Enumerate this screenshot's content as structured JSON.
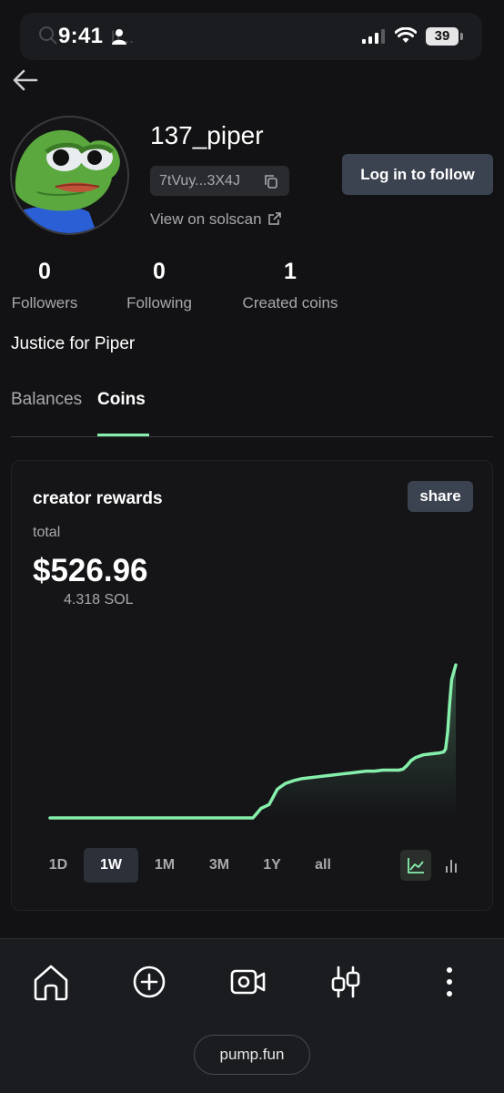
{
  "status_bar": {
    "time": "9:41",
    "battery": "39",
    "search_hint": "h..."
  },
  "profile": {
    "username": "137_piper",
    "address_short": "7tVuy...3X4J",
    "solscan_link": "View on solscan",
    "follow_button": "Log in to follow",
    "bio": "Justice for Piper",
    "stats": [
      {
        "value": "0",
        "label": "Followers"
      },
      {
        "value": "0",
        "label": "Following"
      },
      {
        "value": "1",
        "label": "Created coins"
      }
    ]
  },
  "tabs": [
    {
      "label": "Balances",
      "active": false
    },
    {
      "label": "Coins",
      "active": true
    }
  ],
  "rewards_card": {
    "title": "creator rewards",
    "share_button": "share",
    "total_label": "total",
    "total_value": "$526.96",
    "sol_value": "4.318 SOL",
    "ranges": [
      "1D",
      "1W",
      "1M",
      "3M",
      "1Y",
      "all"
    ],
    "active_range": "1W",
    "accent_color": "#86efac",
    "chart_modes": [
      "line-chart-icon",
      "bar-chart-icon"
    ],
    "active_mode": "line-chart-icon"
  },
  "chart_data": {
    "type": "area",
    "title": "",
    "xlabel": "",
    "ylabel": "",
    "grid": false,
    "x": [
      0,
      0.08,
      0.16,
      0.24,
      0.32,
      0.4,
      0.48,
      0.5,
      0.51,
      0.52,
      0.53,
      0.54,
      0.55,
      0.56,
      0.57,
      0.58,
      0.6,
      0.62,
      0.64,
      0.66,
      0.68,
      0.7,
      0.72,
      0.74,
      0.76,
      0.78,
      0.8,
      0.82,
      0.84,
      0.86,
      0.87,
      0.88,
      0.89,
      0.9,
      0.92,
      0.94,
      0.96,
      0.97,
      0.975,
      0.98,
      0.985,
      0.99,
      1.0
    ],
    "values": [
      0,
      0,
      0,
      0,
      0,
      0,
      0,
      0,
      5,
      10,
      12,
      14,
      22,
      30,
      33,
      36,
      39,
      41,
      42,
      43,
      44,
      45,
      46,
      47,
      48,
      49,
      49,
      50,
      50,
      50,
      51,
      55,
      60,
      63,
      66,
      67,
      68,
      69,
      72,
      90,
      120,
      145,
      160
    ]
  },
  "bottom_nav": {
    "items": [
      "home-icon",
      "create-icon",
      "video-icon",
      "trading-icon",
      "more-icon"
    ],
    "site_pill": "pump.fun"
  }
}
